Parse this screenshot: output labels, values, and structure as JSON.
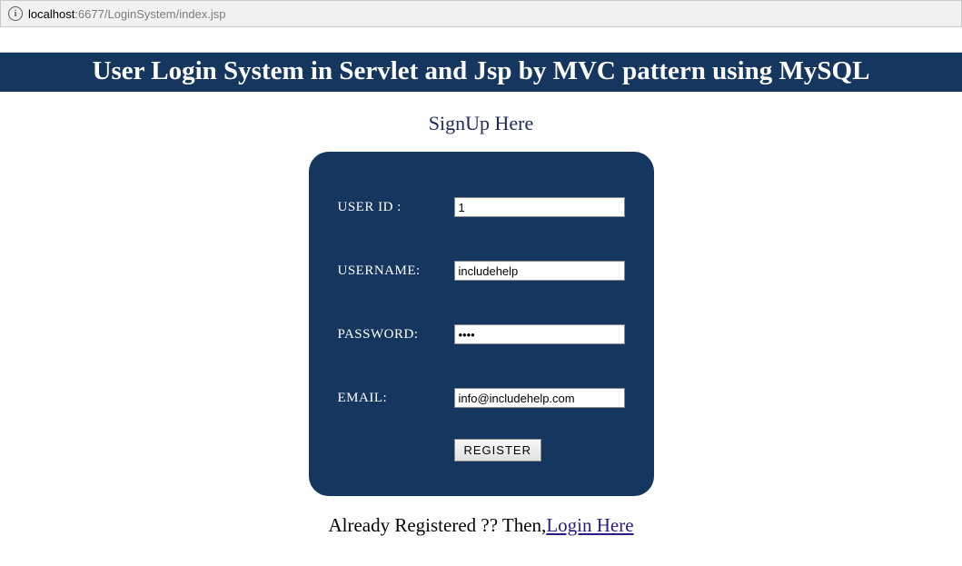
{
  "address": {
    "host": "localhost",
    "path": ":6677/LoginSystem/index.jsp"
  },
  "banner": {
    "title": "User Login System in Servlet and Jsp by MVC pattern using MySQL"
  },
  "signup": {
    "heading": "SignUp Here"
  },
  "form": {
    "userid_label": "USER ID :",
    "userid_value": "1",
    "username_label": "USERNAME:",
    "username_value": "includehelp",
    "password_label": "PASSWORD:",
    "password_value": "••••",
    "email_label": "EMAIL:",
    "email_value": "info@includehelp.com",
    "register_button": "REGISTER"
  },
  "footer": {
    "prefix": "Already Registered ?? Then,",
    "link": "Login Here"
  }
}
